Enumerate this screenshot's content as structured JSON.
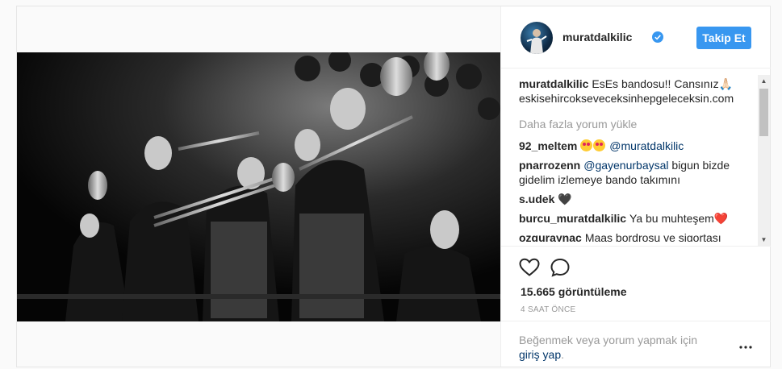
{
  "post": {
    "username": "muratdalkilic",
    "follow_label": "Takip Et",
    "caption_user": "muratdalkilic",
    "caption_text": "EsEs bandosu!! Cansınız🙏🏻 eskisehircokseveceksinhepgeleceksin.com",
    "load_more_label": "Daha fazla yorum yükle",
    "comments": [
      {
        "user": "92_meltem",
        "mention": "@muratdalkilic",
        "text": ""
      },
      {
        "user": "pnarrozenn",
        "mention": "@gayenurbaysal",
        "text": "bigun bizde gidelim izlemeye bando takımını"
      },
      {
        "user": "s.udek",
        "text": "🖤"
      },
      {
        "user": "burcu_muratdalkilic",
        "text": "Ya bu muhteşem❤️"
      },
      {
        "user": "ozguraynac",
        "text": "Maaş bordrosu ve sigortası"
      }
    ],
    "views_label": "15.665 görüntüleme",
    "time_label": "4 SAAT ÖNCE",
    "login_prompt": "Beğenmek veya yorum yapmak için",
    "login_link": "giriş yap",
    "login_period": "."
  },
  "icons": {
    "like": "heart-icon",
    "comment": "comment-icon",
    "verified": "verified-badge-icon",
    "more": "more-options-icon"
  },
  "colors": {
    "follow_button": "#3897f0",
    "link": "#003569",
    "muted": "#999999",
    "verified": "#3897f0"
  }
}
